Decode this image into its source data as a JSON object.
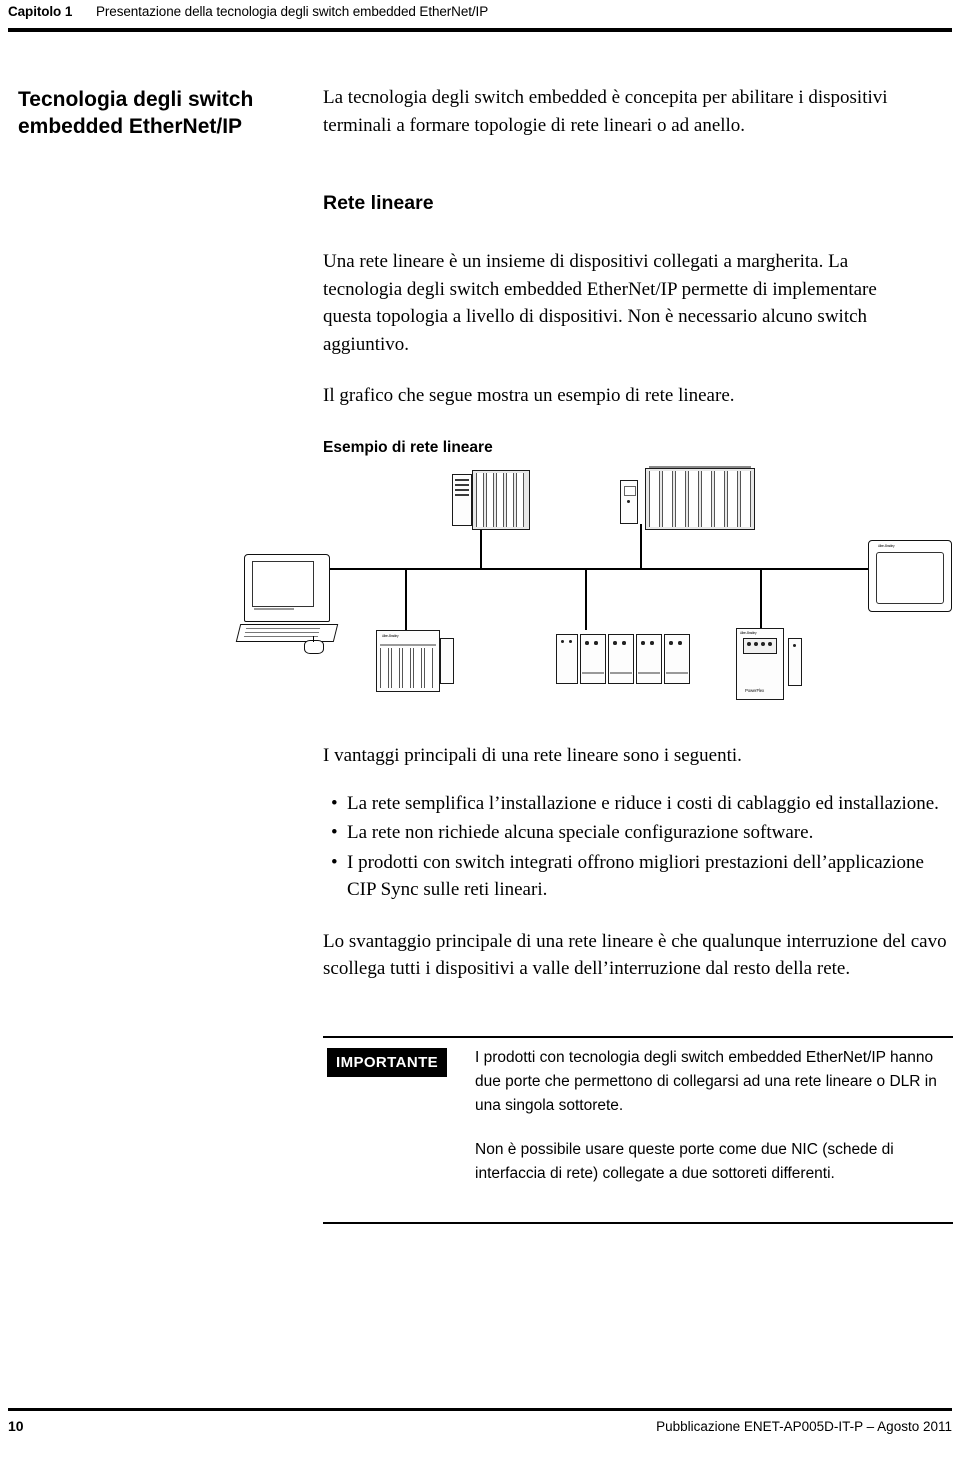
{
  "header": {
    "chapter": "Capitolo 1",
    "title": "Presentazione della tecnologia degli switch embedded EtherNet/IP"
  },
  "side_heading": "Tecnologia degli switch embedded EtherNet/IP",
  "body": {
    "intro": "La tecnologia degli switch embedded è concepita per abilitare i dispositivi terminali a formare topologie di rete lineari o ad anello.",
    "section_title": "Rete lineare",
    "para1": "Una rete lineare è un insieme di dispositivi collegati a margherita. La tecnologia degli switch embedded EtherNet/IP permette di implementare questa topologia a livello di dispositivi. Non è necessario alcuno switch aggiuntivo.",
    "para2": "Il grafico che segue mostra un esempio di rete lineare.",
    "figure_caption": "Esempio di rete lineare",
    "para3": "I vantaggi principali di una rete lineare sono i seguenti.",
    "bullets": [
      "La rete semplifica l’installazione e riduce i costi di cablaggio ed installazione.",
      "La rete non richiede alcuna speciale configurazione software.",
      "I prodotti con switch integrati offrono migliori prestazioni dell’applicazione CIP Sync sulle reti lineari."
    ],
    "para4": "Lo svantaggio principale di una rete lineare è che qualunque interruzione del cavo scollega tutti i dispositivi a valle dell’interruzione dal resto della rete."
  },
  "important_box": {
    "tag": "IMPORTANTE",
    "paragraphs": [
      "I prodotti con tecnologia degli switch embedded EtherNet/IP hanno due porte che permettono di collegarsi ad una rete lineare o DLR in una singola sottorete.",
      "Non è possibile usare queste porte come due NIC (schede di interfaccia di rete) collegate a due sottoreti differenti."
    ]
  },
  "figure_labels": {
    "drive_brand": "Allen-Bradley",
    "drive_name": "PowerFlex",
    "panel_brand": "Allen-Bradley",
    "plc_brand": "Allen-Bradley"
  },
  "footer": {
    "page_number": "10",
    "publication": "Pubblicazione ENET-AP005D-IT-P – Agosto 2011"
  }
}
